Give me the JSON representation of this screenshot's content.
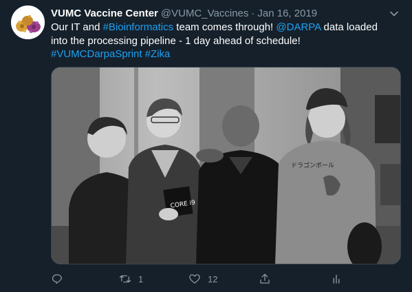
{
  "tweet": {
    "author_name": "VUMC Vaccine Center",
    "handle": "@VUMC_Vaccines",
    "separator": "·",
    "date": "Jan 16, 2019",
    "body": {
      "t1": "Our IT and ",
      "link1": "#Bioinformatics",
      "t2": " team comes through! ",
      "link2": "@DARPA",
      "t3": " data loaded into the processing pipeline - 1 day ahead of schedule!",
      "link3": "#VUMCDarpaSprint",
      "t4": " ",
      "link4": "#Zika"
    },
    "photo": {
      "shirt_text": "ドラゴンボール",
      "box_text": "CORE i9"
    },
    "actions": {
      "reply_icon": "reply-icon",
      "retweet_icon": "retweet-icon",
      "retweet_count": "1",
      "like_icon": "heart-icon",
      "like_count": "12",
      "share_icon": "share-icon",
      "analytics_icon": "analytics-icon"
    }
  },
  "colors": {
    "background": "#15202b",
    "link": "#1da1f2",
    "muted": "#8899a6",
    "text": "#ffffff"
  }
}
